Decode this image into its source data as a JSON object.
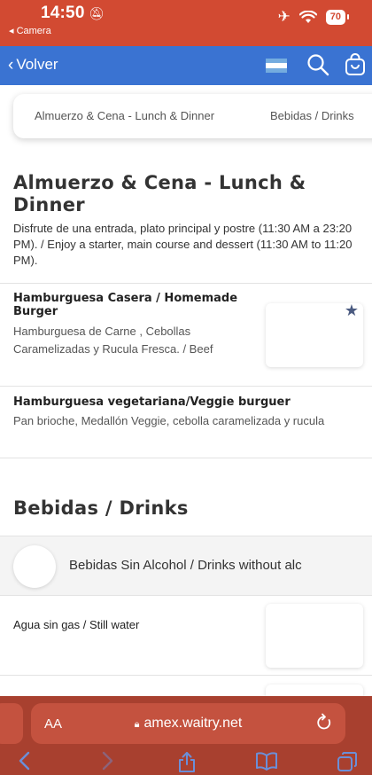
{
  "status_bar": {
    "time": "14:50",
    "back_app": "◂ Camera",
    "battery": "70"
  },
  "nav": {
    "back_label": "Volver"
  },
  "tabs": [
    {
      "label": "Almuerzo & Cena - Lunch & Dinner"
    },
    {
      "label": "Bebidas / Drinks"
    }
  ],
  "sections": [
    {
      "title": "Almuerzo & Cena - Lunch & Dinner",
      "description": "Disfrute de una entrada, plato principal y postre (11:30 AM a 23:20 PM). / Enjoy a starter, main course and dessert (11:30 AM to 11:20 PM).",
      "items": [
        {
          "name": "Hamburguesa Casera / Homemade Burger",
          "description": "Hamburguesa de Carne , Cebollas Caramelizadas y Rucula Fresca. / Beef"
        },
        {
          "name": "Hamburguesa vegetariana/Veggie burguer",
          "description": "Pan brioche, Medallón Veggie, cebolla caramelizada y rucula"
        }
      ]
    },
    {
      "title": "Bebidas / Drinks",
      "category": "Bebidas Sin Alcohol / Drinks without alc",
      "items": [
        {
          "name": "Agua sin gas / Still water"
        }
      ]
    }
  ],
  "browser": {
    "aa_label": "AA",
    "url": "amex.waitry.net"
  },
  "colors": {
    "status_bar": "#d24a32",
    "nav_bar": "#3a73d2",
    "browser_bar": "#a8402f"
  },
  "icons": [
    "bell-slash-icon",
    "airplane-icon",
    "wifi-icon",
    "flag-argentina-icon",
    "search-icon",
    "shopping-bag-icon",
    "star-icon",
    "lock-icon",
    "reload-icon",
    "back-arrow-icon",
    "forward-arrow-icon",
    "share-icon",
    "bookmarks-icon",
    "tabs-icon"
  ]
}
